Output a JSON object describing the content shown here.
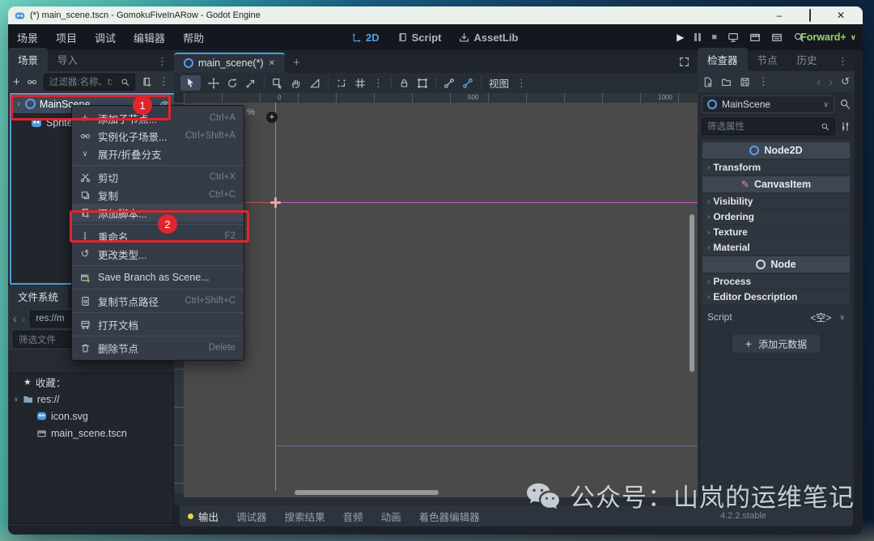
{
  "titlebar": {
    "title": "(*) main_scene.tscn - GomokuFiveInARow - Godot Engine"
  },
  "menubar": {
    "menus": [
      "场景",
      "项目",
      "调试",
      "编辑器",
      "帮助"
    ],
    "workspaces": [
      {
        "label": "2D",
        "active": true
      },
      {
        "label": "Script",
        "active": false
      },
      {
        "label": "AssetLib",
        "active": false
      }
    ],
    "renderer": "Forward+"
  },
  "scene_dock": {
    "tabs": [
      "场景",
      "导入"
    ],
    "filter_placeholder": "过滤器:名称、t:",
    "tree": [
      {
        "label": "MainScene",
        "icon": "node2d-icon"
      },
      {
        "label": "Sprite",
        "icon": "godot-sprite-icon"
      }
    ]
  },
  "context_menu": {
    "items": [
      {
        "label": "添加子节点...",
        "shortcut": "Ctrl+A",
        "icon": "add-icon"
      },
      {
        "label": "实例化子场景...",
        "shortcut": "Ctrl+Shift+A",
        "icon": "link-icon"
      },
      {
        "label": "展开/折叠分支",
        "shortcut": "",
        "icon": "chevron-down-icon"
      },
      {
        "label": "剪切",
        "shortcut": "Ctrl+X",
        "icon": "scissors-icon"
      },
      {
        "label": "复制",
        "shortcut": "Ctrl+C",
        "icon": "copy-icon"
      },
      {
        "label": "添加脚本...",
        "shortcut": "",
        "icon": "script-add-icon"
      },
      {
        "label": "重命名",
        "shortcut": "F2",
        "icon": "rename-icon"
      },
      {
        "label": "更改类型...",
        "shortcut": "",
        "icon": "reload-icon"
      },
      {
        "label": "Save Branch as Scene...",
        "shortcut": "",
        "icon": "scene-save-icon"
      },
      {
        "label": "复制节点路径",
        "shortcut": "Ctrl+Shift+C",
        "icon": "copy-path-icon"
      },
      {
        "label": "打开文档",
        "shortcut": "",
        "icon": "docs-icon"
      },
      {
        "label": "删除节点",
        "shortcut": "Delete",
        "icon": "trash-icon"
      }
    ]
  },
  "filesystem_dock": {
    "tab": "文件系统",
    "path": "res://m",
    "filter_placeholder": "筛选文件",
    "favorites_label": "收藏：",
    "tree": [
      {
        "label": "res://",
        "icon": "folder-icon"
      },
      {
        "label": "icon.svg",
        "icon": "godot-file-icon"
      },
      {
        "label": "main_scene.tscn",
        "icon": "scene-file-icon"
      }
    ]
  },
  "canvas": {
    "tab": "main_scene(*)",
    "view_menu": "视图",
    "ruler_labels": [
      "0",
      "500",
      "1000"
    ],
    "zoom_suffix": "%"
  },
  "bottom_bar": {
    "tabs": [
      "输出",
      "调试器",
      "搜索结果",
      "音频",
      "动画",
      "着色器编辑器"
    ],
    "version": "4.2.2.stable"
  },
  "inspector": {
    "tabs": [
      "检查器",
      "节点",
      "历史"
    ],
    "node_name": "MainScene",
    "filter_placeholder": "筛选属性",
    "sections": [
      {
        "type": "class",
        "label": "Node2D"
      },
      {
        "type": "group",
        "label": "Transform"
      },
      {
        "type": "class",
        "label": "CanvasItem"
      },
      {
        "type": "group",
        "label": "Visibility"
      },
      {
        "type": "group",
        "label": "Ordering"
      },
      {
        "type": "group",
        "label": "Texture"
      },
      {
        "type": "group",
        "label": "Material"
      },
      {
        "type": "class",
        "label": "Node"
      },
      {
        "type": "group",
        "label": "Process"
      },
      {
        "type": "group",
        "label": "Editor Description"
      }
    ],
    "script_label": "Script",
    "script_value": "<空>",
    "add_metadata_label": "添加元数据"
  },
  "annotations": {
    "step1": "1",
    "step2": "2"
  },
  "watermark": {
    "text": "公众号：山岚的运维笔记"
  },
  "icons": {
    "vertical_dots": "⋮",
    "chevron_down": "∨",
    "close": "✕",
    "minimize": "–",
    "star": "★",
    "pencil": "✎",
    "history": "↺",
    "reload": "↺",
    "back": "‹",
    "forward": "›",
    "play": "▶",
    "stop": "■",
    "rename": "I",
    "add": "+"
  },
  "colors": {
    "annotation_red": "#e1252c",
    "accent_blue": "#4da3e8",
    "renderer_green": "#9ed16b",
    "axis_green": "#86ba2c",
    "axis_red": "#c85a5a",
    "viewport_top_magenta": "#ca5fc4",
    "viewport_bottom_violet": "#6b6bb0"
  }
}
